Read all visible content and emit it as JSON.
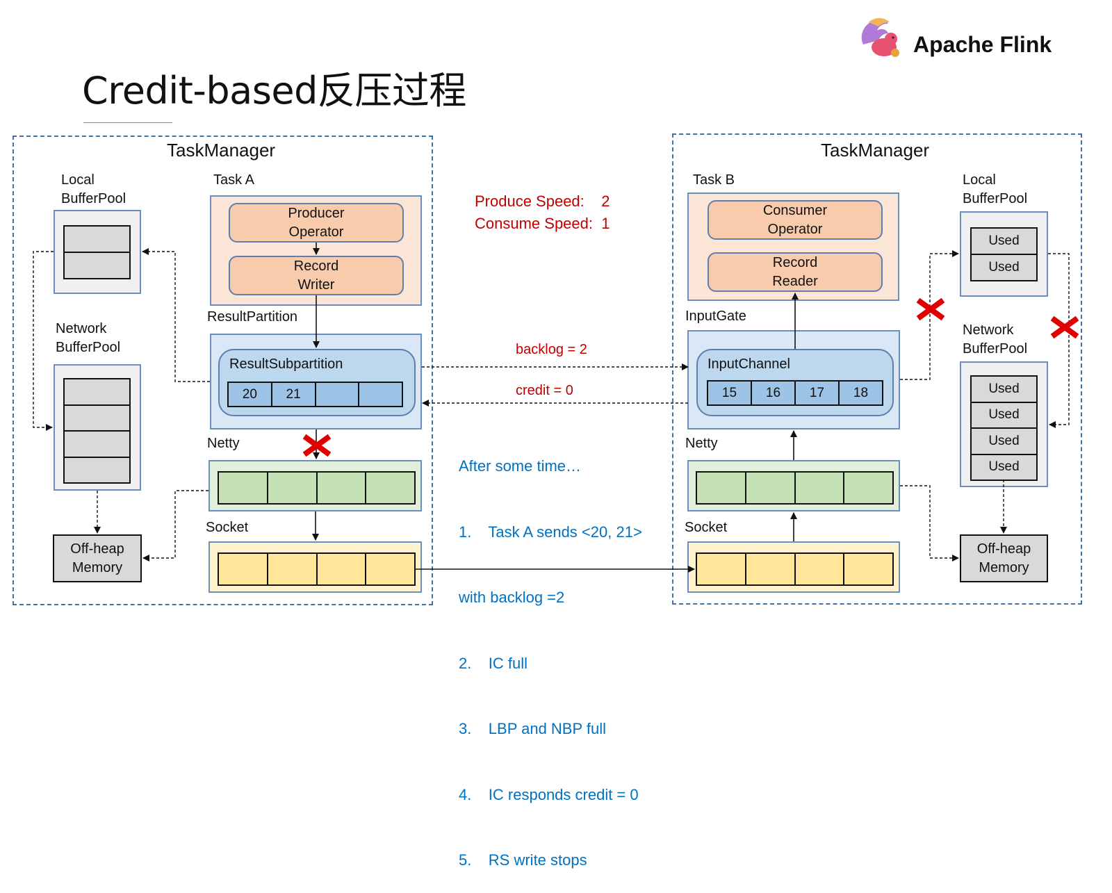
{
  "title": "Credit-based反压过程",
  "brand": {
    "name": "Apache Flink",
    "logo_icon": "flink-squirrel-icon"
  },
  "speeds": {
    "produce": "Produce Speed:    2",
    "consume": "Consume Speed:  1"
  },
  "arrows": {
    "backlog": "backlog = 2",
    "credit": "credit = 0"
  },
  "notes": {
    "heading": "After some time…",
    "steps": [
      "1.    Task A sends <20, 21>",
      "with backlog =2",
      "2.    IC full",
      "3.    LBP and NBP full",
      "4.    IC responds credit = 0",
      "5.    RS write stops"
    ]
  },
  "left": {
    "taskmanager": "TaskManager",
    "local_pool_label": "Local\nBufferPool",
    "local_pool_cells": [
      "",
      ""
    ],
    "network_pool_label": "Network\nBufferPool",
    "network_pool_cells": [
      "",
      "",
      "",
      ""
    ],
    "offheap": "Off-heap\nMemory",
    "task_label": "Task A",
    "operator": "Producer\nOperator",
    "writer": "Record\nWriter",
    "partition_label": "ResultPartition",
    "subpartition_label": "ResultSubpartition",
    "subpartition_cells": [
      "20",
      "21",
      "",
      ""
    ],
    "netty_label": "Netty",
    "netty_cells": [
      "",
      "",
      "",
      ""
    ],
    "socket_label": "Socket",
    "socket_cells": [
      "",
      "",
      "",
      ""
    ]
  },
  "right": {
    "taskmanager": "TaskManager",
    "task_label": "Task B",
    "operator": "Consumer\nOperator",
    "reader": "Record\nReader",
    "gate_label": "InputGate",
    "channel_label": "InputChannel",
    "channel_cells": [
      "15",
      "16",
      "17",
      "18"
    ],
    "netty_label": "Netty",
    "netty_cells": [
      "",
      "",
      "",
      ""
    ],
    "socket_label": "Socket",
    "socket_cells": [
      "",
      "",
      "",
      ""
    ],
    "local_pool_label": "Local\nBufferPool",
    "local_pool_cells": [
      "Used",
      "Used"
    ],
    "network_pool_label": "Network\nBufferPool",
    "network_pool_cells": [
      "Used",
      "Used",
      "Used",
      "Used"
    ],
    "offheap": "Off-heap\nMemory"
  },
  "colors": {
    "alert_red": "#c00000",
    "note_blue": "#0070c0",
    "cross_red": "#ff0000"
  }
}
